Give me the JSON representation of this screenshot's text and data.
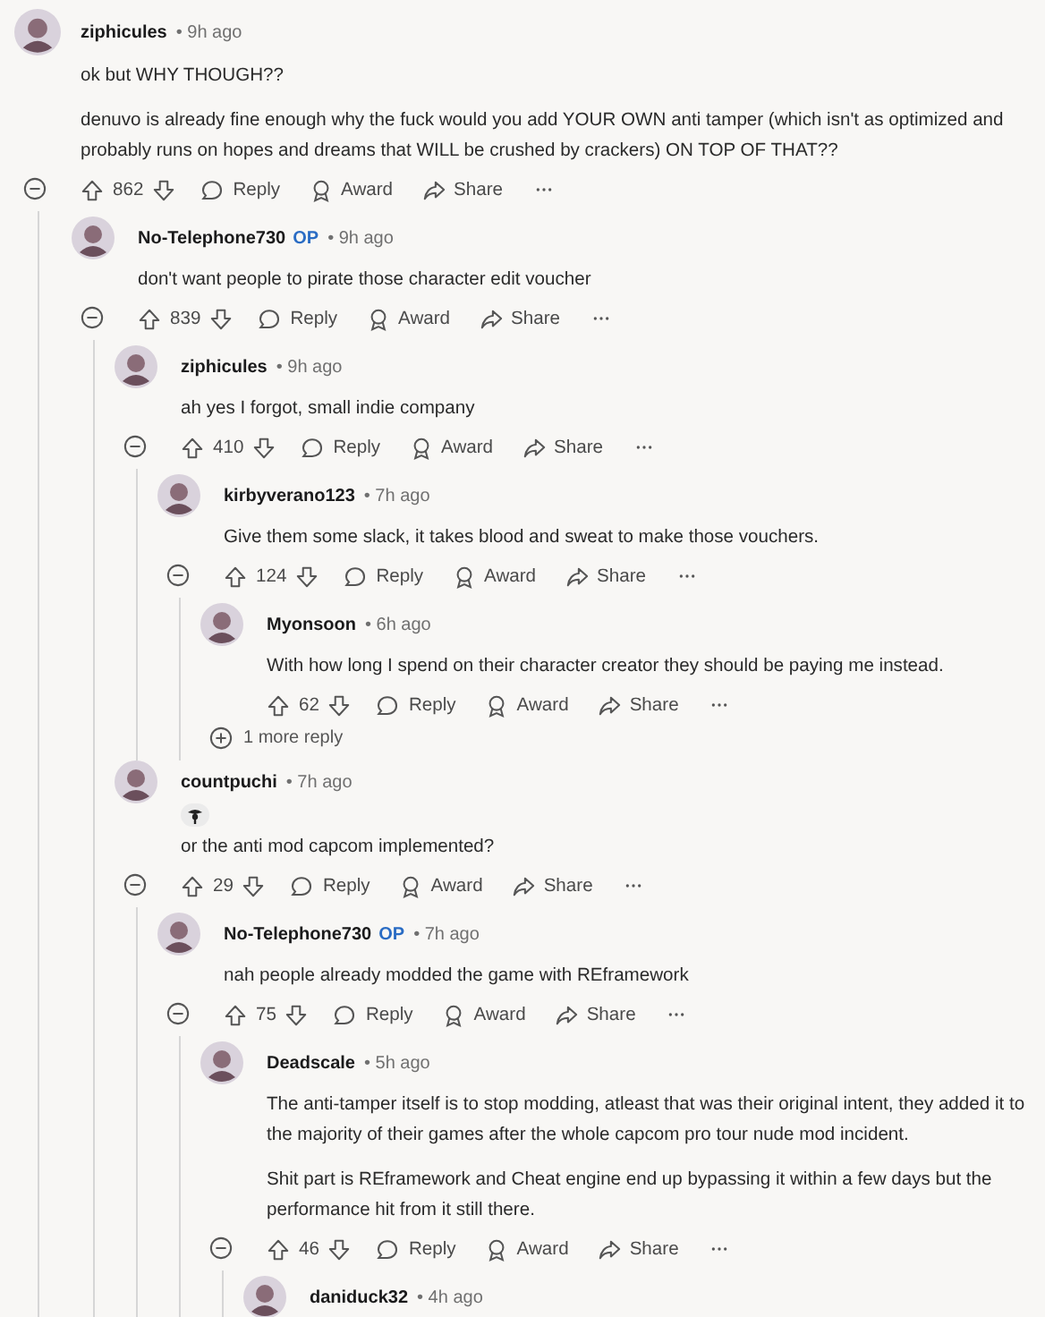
{
  "comments": [
    {
      "kind": "comment",
      "author": "ziphicules",
      "time": "• 9h ago",
      "paragraphs": [
        "ok but WHY THOUGH??",
        "denuvo is already fine enough why the fuck would you add YOUR OWN anti tamper (which isn't as optimized and probably runs on hopes and dreams that WILL be crushed by crackers) ON TOP OF THAT??"
      ],
      "actions": {
        "votes": "862",
        "reply": "Reply",
        "award": "Award",
        "share": "Share"
      },
      "children": [
        {
          "kind": "comment",
          "author": "No-Telephone730",
          "op_badge": "OP",
          "time": "• 9h ago",
          "paragraphs": [
            "don't want people to pirate those character edit voucher"
          ],
          "actions": {
            "votes": "839",
            "reply": "Reply",
            "award": "Award",
            "share": "Share"
          },
          "children": [
            {
              "kind": "comment",
              "author": "ziphicules",
              "time": "• 9h ago",
              "paragraphs": [
                "ah yes I forgot, small indie company"
              ],
              "actions": {
                "votes": "410",
                "reply": "Reply",
                "award": "Award",
                "share": "Share"
              },
              "children": [
                {
                  "kind": "comment",
                  "author": "kirbyverano123",
                  "time": "• 7h ago",
                  "paragraphs": [
                    "Give them some slack, it takes blood and sweat to make those vouchers."
                  ],
                  "actions": {
                    "votes": "124",
                    "reply": "Reply",
                    "award": "Award",
                    "share": "Share"
                  },
                  "children": [
                    {
                      "kind": "comment",
                      "author": "Myonsoon",
                      "time": "• 6h ago",
                      "paragraphs": [
                        "With how long I spend on their character creator they should be paying me instead."
                      ],
                      "actions": {
                        "votes": "62",
                        "reply": "Reply",
                        "award": "Award",
                        "share": "Share"
                      }
                    },
                    {
                      "kind": "more",
                      "label": "1 more reply"
                    }
                  ]
                }
              ]
            },
            {
              "kind": "comment",
              "author": "countpuchi",
              "time": "• 7h ago",
              "flair": true,
              "paragraphs": [
                "or the anti mod capcom implemented?"
              ],
              "actions": {
                "votes": "29",
                "reply": "Reply",
                "award": "Award",
                "share": "Share"
              },
              "children": [
                {
                  "kind": "comment",
                  "author": "No-Telephone730",
                  "op_badge": "OP",
                  "time": "• 7h ago",
                  "paragraphs": [
                    "nah people already modded the game with REframework"
                  ],
                  "actions": {
                    "votes": "75",
                    "reply": "Reply",
                    "award": "Award",
                    "share": "Share"
                  },
                  "children": [
                    {
                      "kind": "comment",
                      "author": "Deadscale",
                      "time": "• 5h ago",
                      "paragraphs": [
                        "The anti-tamper itself is to stop modding, atleast that was their original intent, they added it to the majority of their games after the whole capcom pro tour nude mod incident.",
                        "Shit part is REframework and Cheat engine end up bypassing it within a few days but the performance hit from it still there."
                      ],
                      "actions": {
                        "votes": "46",
                        "reply": "Reply",
                        "award": "Award",
                        "share": "Share"
                      },
                      "children": [
                        {
                          "kind": "comment",
                          "author": "daniduck32",
                          "time": "• 4h ago"
                        }
                      ]
                    }
                  ]
                }
              ]
            }
          ]
        }
      ]
    }
  ]
}
